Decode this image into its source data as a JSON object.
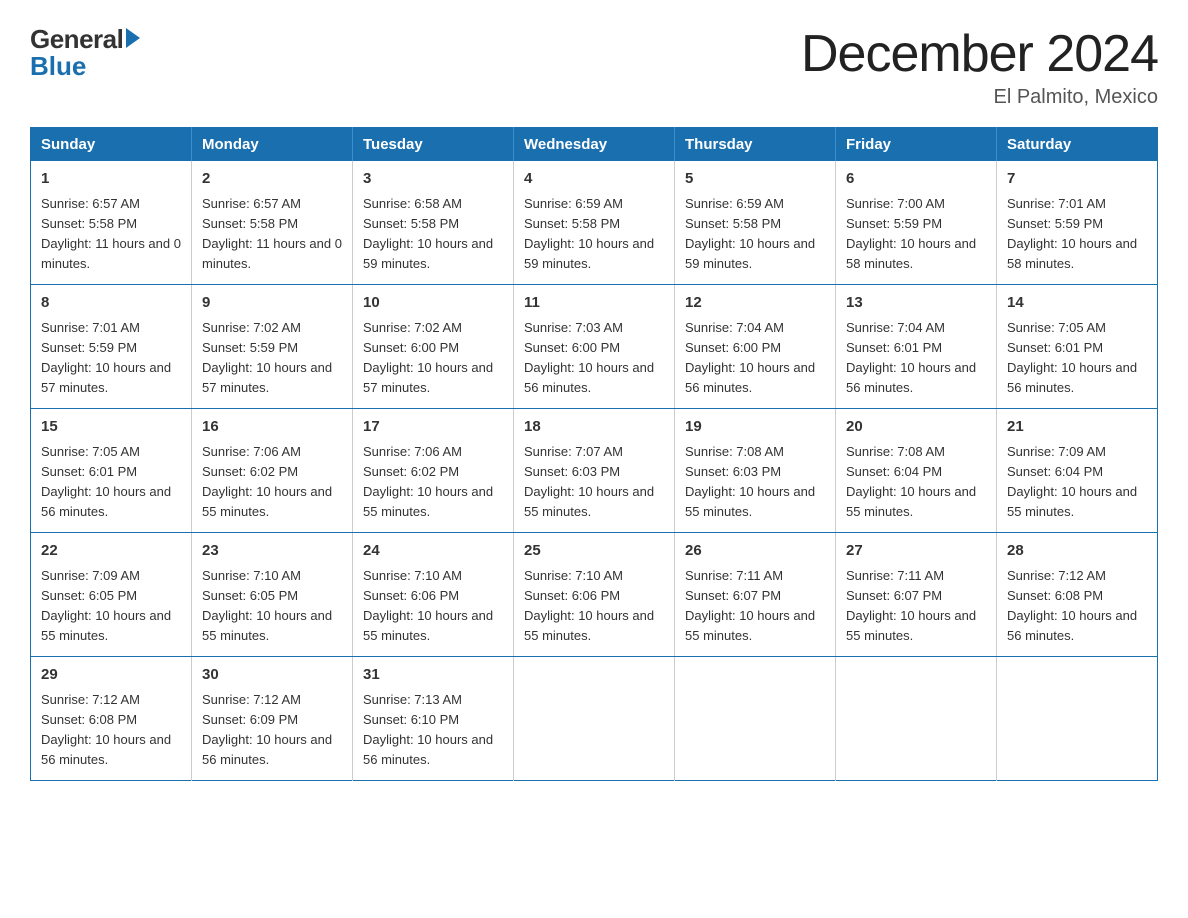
{
  "logo": {
    "general": "General",
    "blue": "Blue"
  },
  "header": {
    "month_title": "December 2024",
    "location": "El Palmito, Mexico"
  },
  "days_of_week": [
    "Sunday",
    "Monday",
    "Tuesday",
    "Wednesday",
    "Thursday",
    "Friday",
    "Saturday"
  ],
  "weeks": [
    [
      {
        "day": "1",
        "sunrise": "6:57 AM",
        "sunset": "5:58 PM",
        "daylight": "11 hours and 0 minutes."
      },
      {
        "day": "2",
        "sunrise": "6:57 AM",
        "sunset": "5:58 PM",
        "daylight": "11 hours and 0 minutes."
      },
      {
        "day": "3",
        "sunrise": "6:58 AM",
        "sunset": "5:58 PM",
        "daylight": "10 hours and 59 minutes."
      },
      {
        "day": "4",
        "sunrise": "6:59 AM",
        "sunset": "5:58 PM",
        "daylight": "10 hours and 59 minutes."
      },
      {
        "day": "5",
        "sunrise": "6:59 AM",
        "sunset": "5:58 PM",
        "daylight": "10 hours and 59 minutes."
      },
      {
        "day": "6",
        "sunrise": "7:00 AM",
        "sunset": "5:59 PM",
        "daylight": "10 hours and 58 minutes."
      },
      {
        "day": "7",
        "sunrise": "7:01 AM",
        "sunset": "5:59 PM",
        "daylight": "10 hours and 58 minutes."
      }
    ],
    [
      {
        "day": "8",
        "sunrise": "7:01 AM",
        "sunset": "5:59 PM",
        "daylight": "10 hours and 57 minutes."
      },
      {
        "day": "9",
        "sunrise": "7:02 AM",
        "sunset": "5:59 PM",
        "daylight": "10 hours and 57 minutes."
      },
      {
        "day": "10",
        "sunrise": "7:02 AM",
        "sunset": "6:00 PM",
        "daylight": "10 hours and 57 minutes."
      },
      {
        "day": "11",
        "sunrise": "7:03 AM",
        "sunset": "6:00 PM",
        "daylight": "10 hours and 56 minutes."
      },
      {
        "day": "12",
        "sunrise": "7:04 AM",
        "sunset": "6:00 PM",
        "daylight": "10 hours and 56 minutes."
      },
      {
        "day": "13",
        "sunrise": "7:04 AM",
        "sunset": "6:01 PM",
        "daylight": "10 hours and 56 minutes."
      },
      {
        "day": "14",
        "sunrise": "7:05 AM",
        "sunset": "6:01 PM",
        "daylight": "10 hours and 56 minutes."
      }
    ],
    [
      {
        "day": "15",
        "sunrise": "7:05 AM",
        "sunset": "6:01 PM",
        "daylight": "10 hours and 56 minutes."
      },
      {
        "day": "16",
        "sunrise": "7:06 AM",
        "sunset": "6:02 PM",
        "daylight": "10 hours and 55 minutes."
      },
      {
        "day": "17",
        "sunrise": "7:06 AM",
        "sunset": "6:02 PM",
        "daylight": "10 hours and 55 minutes."
      },
      {
        "day": "18",
        "sunrise": "7:07 AM",
        "sunset": "6:03 PM",
        "daylight": "10 hours and 55 minutes."
      },
      {
        "day": "19",
        "sunrise": "7:08 AM",
        "sunset": "6:03 PM",
        "daylight": "10 hours and 55 minutes."
      },
      {
        "day": "20",
        "sunrise": "7:08 AM",
        "sunset": "6:04 PM",
        "daylight": "10 hours and 55 minutes."
      },
      {
        "day": "21",
        "sunrise": "7:09 AM",
        "sunset": "6:04 PM",
        "daylight": "10 hours and 55 minutes."
      }
    ],
    [
      {
        "day": "22",
        "sunrise": "7:09 AM",
        "sunset": "6:05 PM",
        "daylight": "10 hours and 55 minutes."
      },
      {
        "day": "23",
        "sunrise": "7:10 AM",
        "sunset": "6:05 PM",
        "daylight": "10 hours and 55 minutes."
      },
      {
        "day": "24",
        "sunrise": "7:10 AM",
        "sunset": "6:06 PM",
        "daylight": "10 hours and 55 minutes."
      },
      {
        "day": "25",
        "sunrise": "7:10 AM",
        "sunset": "6:06 PM",
        "daylight": "10 hours and 55 minutes."
      },
      {
        "day": "26",
        "sunrise": "7:11 AM",
        "sunset": "6:07 PM",
        "daylight": "10 hours and 55 minutes."
      },
      {
        "day": "27",
        "sunrise": "7:11 AM",
        "sunset": "6:07 PM",
        "daylight": "10 hours and 55 minutes."
      },
      {
        "day": "28",
        "sunrise": "7:12 AM",
        "sunset": "6:08 PM",
        "daylight": "10 hours and 56 minutes."
      }
    ],
    [
      {
        "day": "29",
        "sunrise": "7:12 AM",
        "sunset": "6:08 PM",
        "daylight": "10 hours and 56 minutes."
      },
      {
        "day": "30",
        "sunrise": "7:12 AM",
        "sunset": "6:09 PM",
        "daylight": "10 hours and 56 minutes."
      },
      {
        "day": "31",
        "sunrise": "7:13 AM",
        "sunset": "6:10 PM",
        "daylight": "10 hours and 56 minutes."
      },
      null,
      null,
      null,
      null
    ]
  ]
}
